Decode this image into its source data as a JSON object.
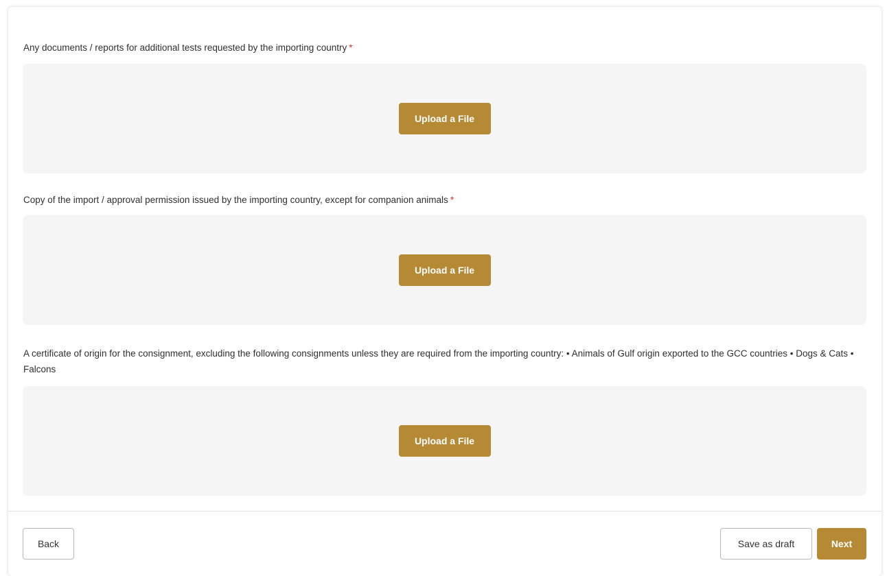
{
  "colors": {
    "accent": "#b68a35",
    "required": "#d0312d",
    "drop_zone_bg": "#f5f5f5"
  },
  "fields": [
    {
      "label": "Any documents / reports for additional tests requested by the importing country",
      "required_mark": "*",
      "upload_label": "Upload a File"
    },
    {
      "label": "Copy of the import / approval permission issued by the importing country, except for companion animals",
      "required_mark": "*",
      "upload_label": "Upload a File"
    },
    {
      "label": "A certificate of origin for the consignment, excluding the following consignments unless they are required from the importing country: • Animals of Gulf origin exported to the GCC countries • Dogs & Cats • Falcons",
      "upload_label": "Upload a File"
    }
  ],
  "footer": {
    "back_label": "Back",
    "save_draft_label": "Save as draft",
    "next_label": "Next"
  }
}
